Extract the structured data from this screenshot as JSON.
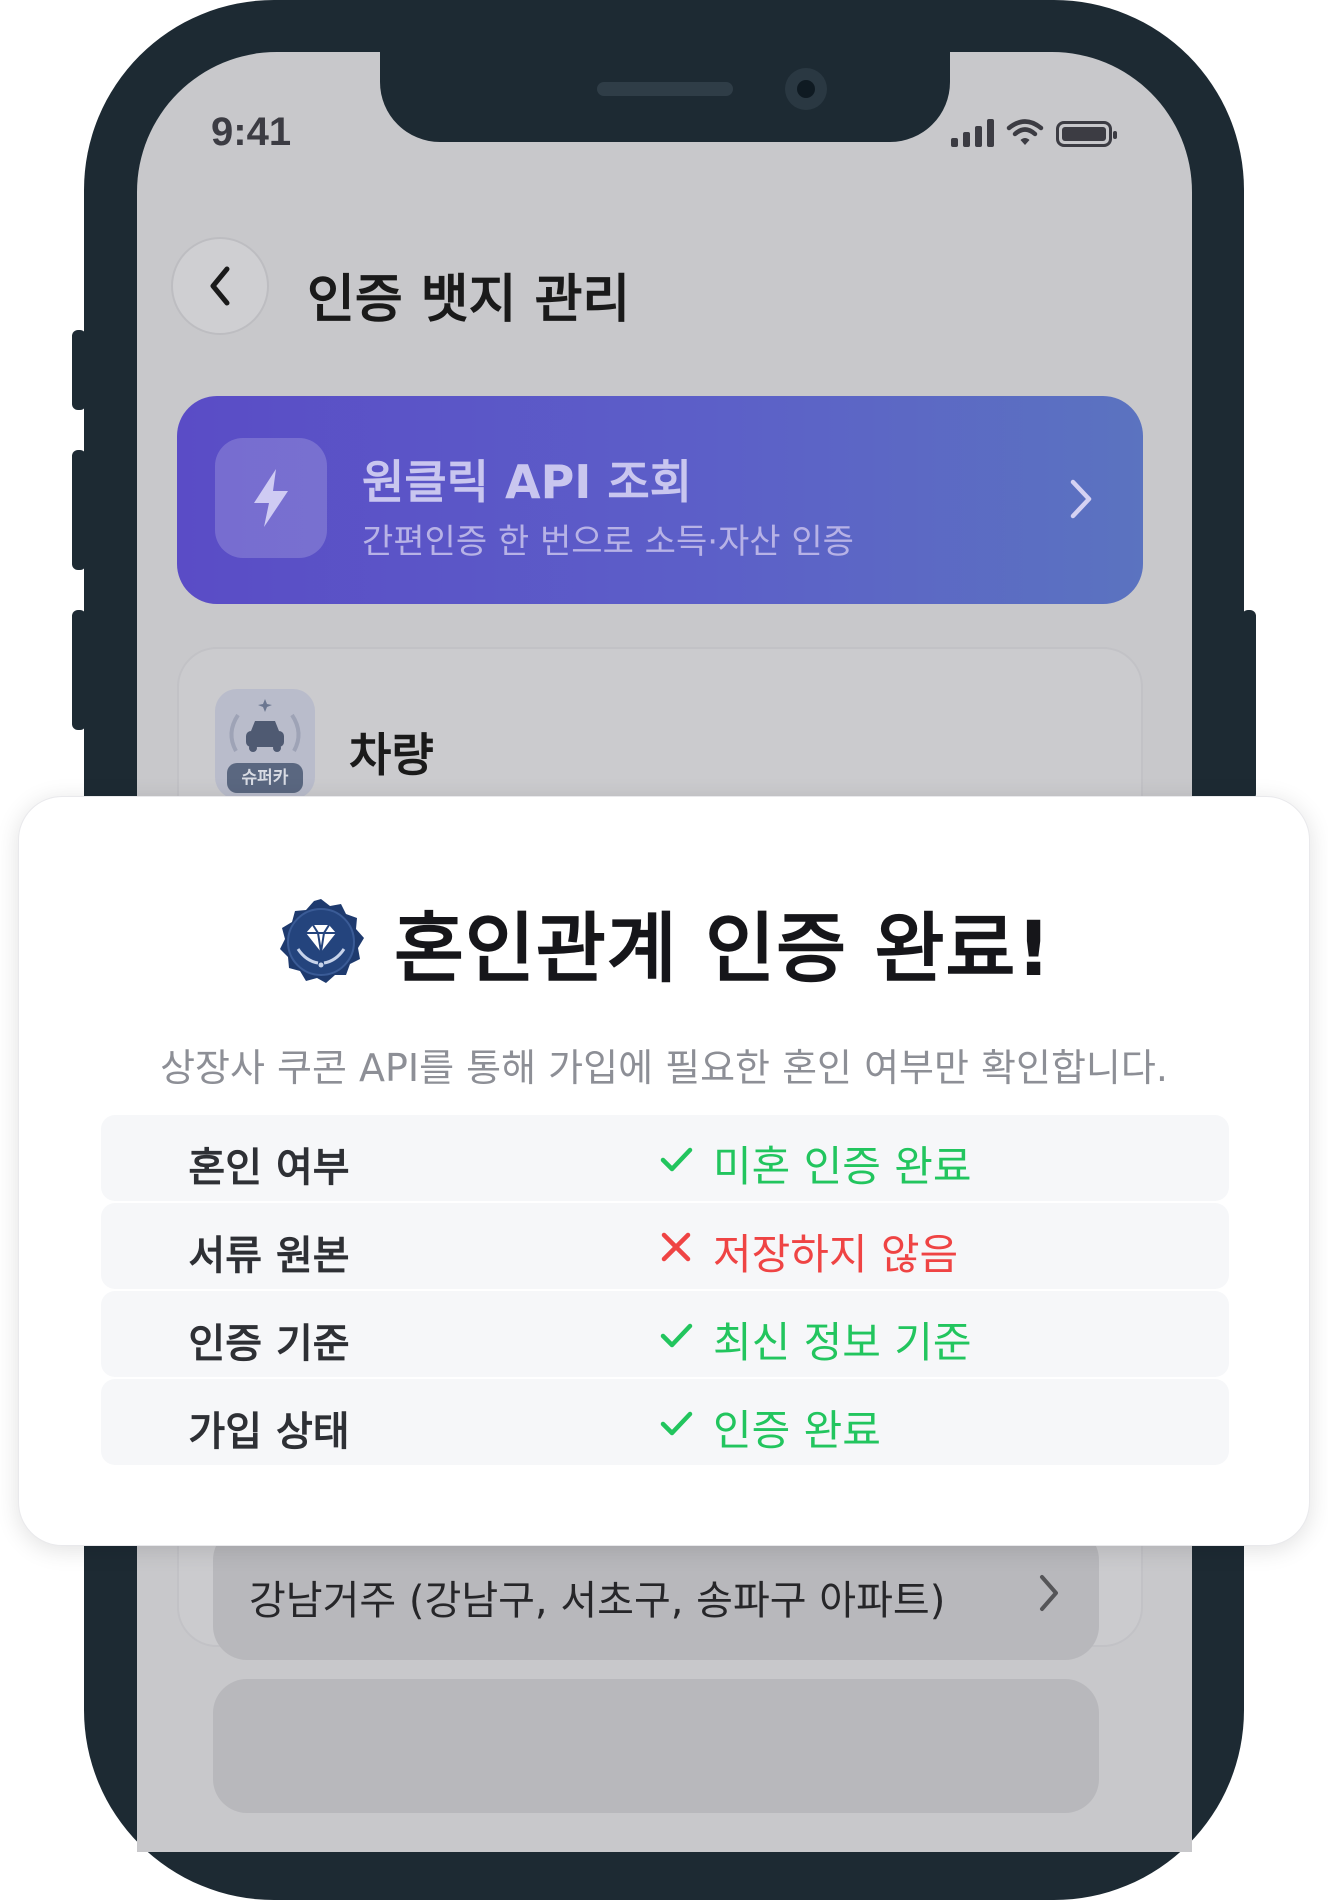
{
  "status_bar": {
    "time": "9:41"
  },
  "header": {
    "title": "인증 뱃지 관리"
  },
  "api_card": {
    "title": "원클릭 API 조회",
    "subtitle": "간편인증 한 번으로 소득·자산 인증"
  },
  "car_section": {
    "title": "차량",
    "badge_label": "슈퍼카"
  },
  "location_item": {
    "label": "강남거주 (강남구, 서초구, 송파구 아파트)"
  },
  "modal": {
    "title": "혼인관계 인증 완료!",
    "description": "상장사 쿠콘 API를 통해 가입에 필요한 혼인 여부만 확인합니다.",
    "rows": [
      {
        "key": "혼인 여부",
        "value": "미혼 인증 완료",
        "status": "ok"
      },
      {
        "key": "서류 원본",
        "value": "저장하지 않음",
        "status": "no"
      },
      {
        "key": "인증 기준",
        "value": "최신 정보 기준",
        "status": "ok"
      },
      {
        "key": "가입 상태",
        "value": "인증 완료",
        "status": "ok"
      }
    ]
  },
  "colors": {
    "ok": "#22c55e",
    "no": "#ef4444",
    "api_gradient_start": "#5a4cc6",
    "api_gradient_end": "#5b73c0",
    "badge_navy": "#1e3a6e"
  }
}
